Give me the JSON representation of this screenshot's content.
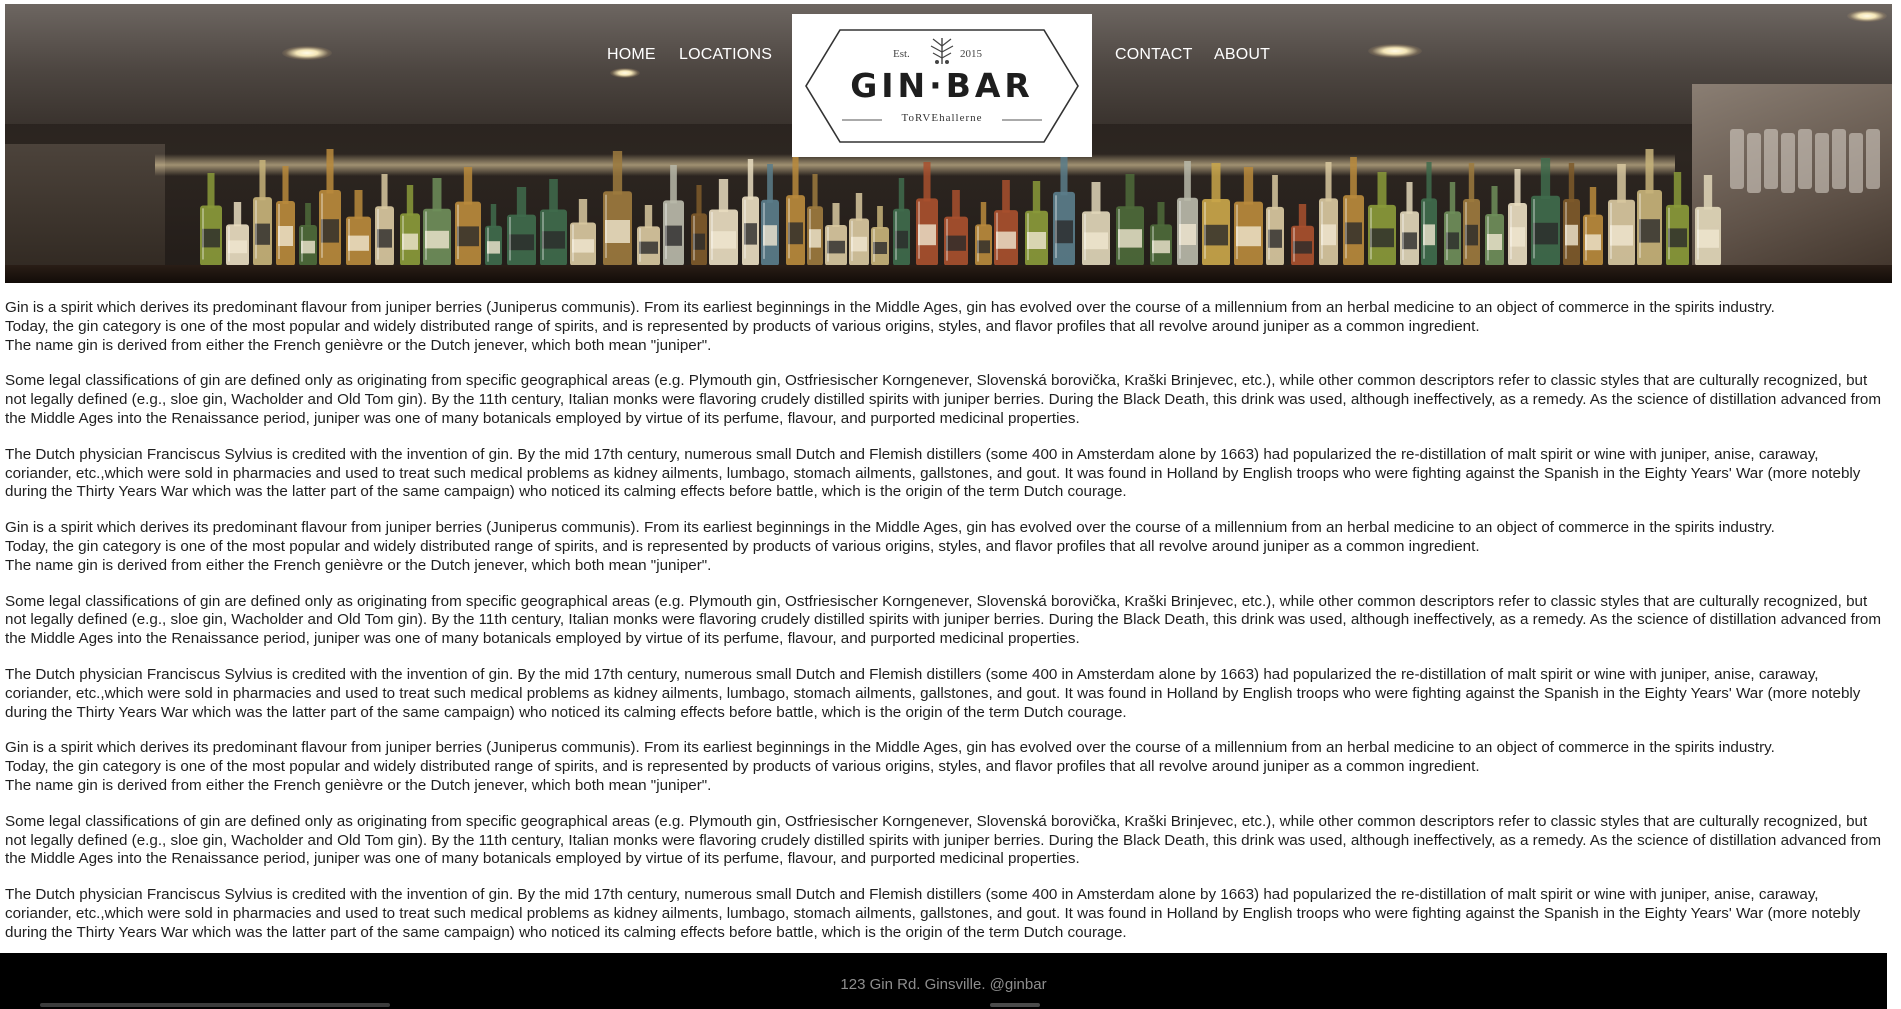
{
  "nav": {
    "home": "HOME",
    "locations": "LOCATIONS",
    "contact": "CONTACT",
    "about": "ABOUT"
  },
  "logo": {
    "est": "Est.",
    "year": "2015",
    "name": "GIN·BAR",
    "subtitle": "ToRVEhallerne"
  },
  "content": {
    "paragraphs": [
      "Gin is a spirit which derives its predominant flavour from juniper berries (Juniperus communis). From its earliest beginnings in the Middle Ages, gin has evolved over the course of a millennium from an herbal medicine to an object of commerce in the spirits industry.\nToday, the gin category is one of the most popular and widely distributed range of spirits, and is represented by products of various origins, styles, and flavor profiles that all revolve around juniper as a common ingredient.\nThe name gin is derived from either the French genièvre or the Dutch jenever, which both mean \"juniper\".",
      "Some legal classifications of gin are defined only as originating from specific geographical areas (e.g. Plymouth gin, Ostfriesischer Korngenever, Slovenská borovička, Kraški Brinjevec, etc.), while other common descriptors refer to classic styles that are culturally recognized, but not legally defined (e.g., sloe gin, Wacholder and Old Tom gin). By the 11th century, Italian monks were flavoring crudely distilled spirits with juniper berries. During the Black Death, this drink was used, although ineffectively, as a remedy. As the science of distillation advanced from the Middle Ages into the Renaissance period, juniper was one of many botanicals employed by virtue of its perfume, flavour, and purported medicinal properties.",
      "The Dutch physician Franciscus Sylvius is credited with the invention of gin. By the mid 17th century, numerous small Dutch and Flemish distillers (some 400 in Amsterdam alone by 1663) had popularized the re-distillation of malt spirit or wine with juniper, anise, caraway, coriander, etc.,which were sold in pharmacies and used to treat such medical problems as kidney ailments, lumbago, stomach ailments, gallstones, and gout. It was found in Holland by English troops who were fighting against the Spanish in the Eighty Years' War (more notebly during the Thirty Years War which was the latter part of the same campaign) who noticed its calming effects before battle, which is the origin of the term Dutch courage.",
      "Gin is a spirit which derives its predominant flavour from juniper berries (Juniperus communis). From its earliest beginnings in the Middle Ages, gin has evolved over the course of a millennium from an herbal medicine to an object of commerce in the spirits industry.\nToday, the gin category is one of the most popular and widely distributed range of spirits, and is represented by products of various origins, styles, and flavor profiles that all revolve around juniper as a common ingredient.\nThe name gin is derived from either the French genièvre or the Dutch jenever, which both mean \"juniper\".",
      "Some legal classifications of gin are defined only as originating from specific geographical areas (e.g. Plymouth gin, Ostfriesischer Korngenever, Slovenská borovička, Kraški Brinjevec, etc.), while other common descriptors refer to classic styles that are culturally recognized, but not legally defined (e.g., sloe gin, Wacholder and Old Tom gin). By the 11th century, Italian monks were flavoring crudely distilled spirits with juniper berries. During the Black Death, this drink was used, although ineffectively, as a remedy. As the science of distillation advanced from the Middle Ages into the Renaissance period, juniper was one of many botanicals employed by virtue of its perfume, flavour, and purported medicinal properties.",
      "The Dutch physician Franciscus Sylvius is credited with the invention of gin. By the mid 17th century, numerous small Dutch and Flemish distillers (some 400 in Amsterdam alone by 1663) had popularized the re-distillation of malt spirit or wine with juniper, anise, caraway, coriander, etc.,which were sold in pharmacies and used to treat such medical problems as kidney ailments, lumbago, stomach ailments, gallstones, and gout. It was found in Holland by English troops who were fighting against the Spanish in the Eighty Years' War (more notebly during the Thirty Years War which was the latter part of the same campaign) who noticed its calming effects before battle, which is the origin of the term Dutch courage.",
      "Gin is a spirit which derives its predominant flavour from juniper berries (Juniperus communis). From its earliest beginnings in the Middle Ages, gin has evolved over the course of a millennium from an herbal medicine to an object of commerce in the spirits industry.\nToday, the gin category is one of the most popular and widely distributed range of spirits, and is represented by products of various origins, styles, and flavor profiles that all revolve around juniper as a common ingredient.\nThe name gin is derived from either the French genièvre or the Dutch jenever, which both mean \"juniper\".",
      "Some legal classifications of gin are defined only as originating from specific geographical areas (e.g. Plymouth gin, Ostfriesischer Korngenever, Slovenská borovička, Kraški Brinjevec, etc.), while other common descriptors refer to classic styles that are culturally recognized, but not legally defined (e.g., sloe gin, Wacholder and Old Tom gin). By the 11th century, Italian monks were flavoring crudely distilled spirits with juniper berries. During the Black Death, this drink was used, although ineffectively, as a remedy. As the science of distillation advanced from the Middle Ages into the Renaissance period, juniper was one of many botanicals employed by virtue of its perfume, flavour, and purported medicinal properties.",
      "The Dutch physician Franciscus Sylvius is credited with the invention of gin. By the mid 17th century, numerous small Dutch and Flemish distillers (some 400 in Amsterdam alone by 1663) had popularized the re-distillation of malt spirit or wine with juniper, anise, caraway, coriander, etc.,which were sold in pharmacies and used to treat such medical problems as kidney ailments, lumbago, stomach ailments, gallstones, and gout. It was found in Holland by English troops who were fighting against the Spanish in the Eighty Years' War (more notebly during the Thirty Years War which was the latter part of the same campaign) who noticed its calming effects before battle, which is the origin of the term Dutch courage."
    ]
  },
  "footer": {
    "text": "123 Gin Rd. Ginsville. @ginbar"
  },
  "colors": {
    "footer_bg": "#000000",
    "footer_text": "#8e8e8e",
    "nav_text": "#ffffff",
    "body_text": "#1f1f1f"
  },
  "icons": {
    "logo_emblem": "juniper-sprig-icon"
  }
}
